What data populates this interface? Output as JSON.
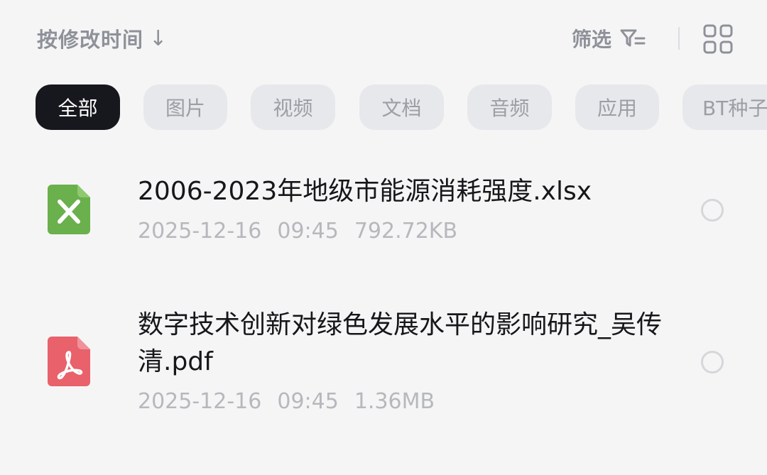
{
  "toolbar": {
    "sort_label": "按修改时间",
    "sort_arrow": "↓",
    "filter_label": "筛选"
  },
  "tabs": [
    {
      "label": "全部",
      "active": true
    },
    {
      "label": "图片",
      "active": false
    },
    {
      "label": "视频",
      "active": false
    },
    {
      "label": "文档",
      "active": false
    },
    {
      "label": "音频",
      "active": false
    },
    {
      "label": "应用",
      "active": false
    },
    {
      "label": "BT种子",
      "active": false
    }
  ],
  "files": [
    {
      "name": "2006-2023年地级市能源消耗强度.xlsx",
      "date": "2025-12-16",
      "time": "09:45",
      "size": "792.72KB",
      "icon": "excel-icon",
      "icon_color": "#6ab04c"
    },
    {
      "name": "数字技术创新对绿色发展水平的影响研究_吴传清.pdf",
      "date": "2025-12-16",
      "time": "09:45",
      "size": "1.36MB",
      "icon": "pdf-icon",
      "icon_color": "#e8616b"
    }
  ],
  "colors": {
    "background": "#f5f5f5",
    "active_chip": "#17181d",
    "inactive_chip": "#e7e8eb",
    "meta_text": "#b6b8bd"
  }
}
